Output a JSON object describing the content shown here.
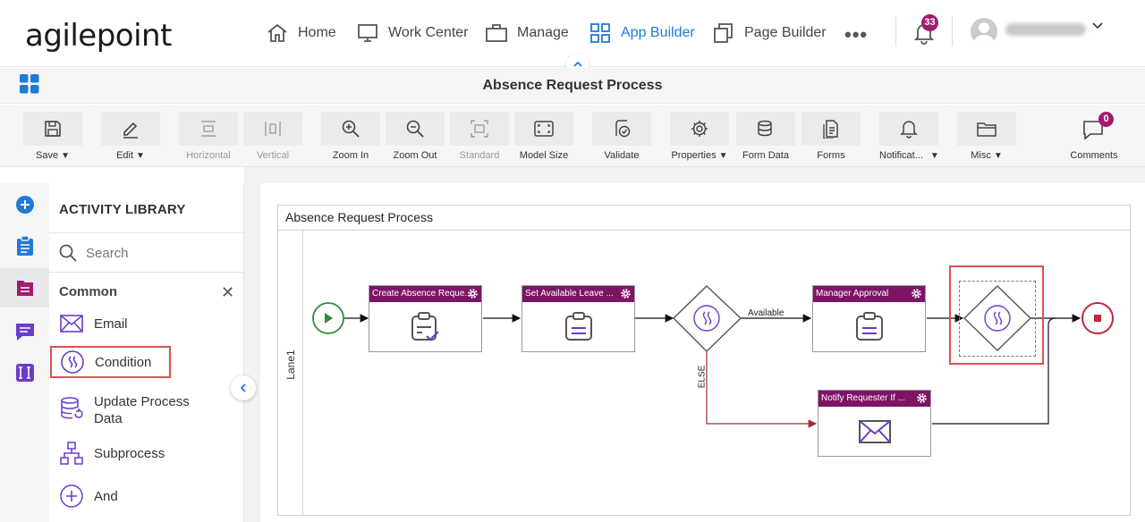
{
  "brand": {
    "logo_text": "agilepoint",
    "accent": "#1f7ad6",
    "activity_header_color": "#7d1466"
  },
  "nav": {
    "items": [
      {
        "label": "Home",
        "icon": "home-icon"
      },
      {
        "label": "Work Center",
        "icon": "monitor-icon"
      },
      {
        "label": "Manage",
        "icon": "briefcase-icon"
      },
      {
        "label": "App Builder",
        "icon": "grid-icon",
        "active": true
      },
      {
        "label": "Page Builder",
        "icon": "pages-icon"
      }
    ],
    "more": "•••",
    "notification_count": "33"
  },
  "title_bar": {
    "title": "Absence Request Process"
  },
  "toolbar": {
    "save": "Save",
    "edit": "Edit",
    "horizontal": "Horizontal",
    "vertical": "Vertical",
    "zoom_in": "Zoom In",
    "zoom_out": "Zoom Out",
    "standard": "Standard",
    "model_size": "Model Size",
    "validate": "Validate",
    "properties": "Properties",
    "form_data": "Form Data",
    "forms": "Forms",
    "notifications": "Notificat...",
    "misc": "Misc",
    "comments": "Comments",
    "comments_count": "0"
  },
  "library": {
    "title": "ACTIVITY LIBRARY",
    "search_placeholder": "Search",
    "section": "Common",
    "items": [
      {
        "label": "Email",
        "icon": "email-icon"
      },
      {
        "label": "Condition",
        "icon": "condition-icon",
        "selected": true
      },
      {
        "label": "Update Process",
        "label2": "Data",
        "icon": "update-data-icon"
      },
      {
        "label": "Subprocess",
        "icon": "subprocess-icon"
      },
      {
        "label": "And",
        "icon": "and-icon"
      }
    ]
  },
  "diagram": {
    "pool_title": "Absence Request Process",
    "lane": "Lane1",
    "activities": {
      "create": "Create Absence Reque...",
      "set_leave": "Set Available Leave ...",
      "manager": "Manager Approval",
      "notify": "Notify Requester If ..."
    },
    "flows": {
      "available": "Available",
      "else": "ELSE"
    }
  }
}
